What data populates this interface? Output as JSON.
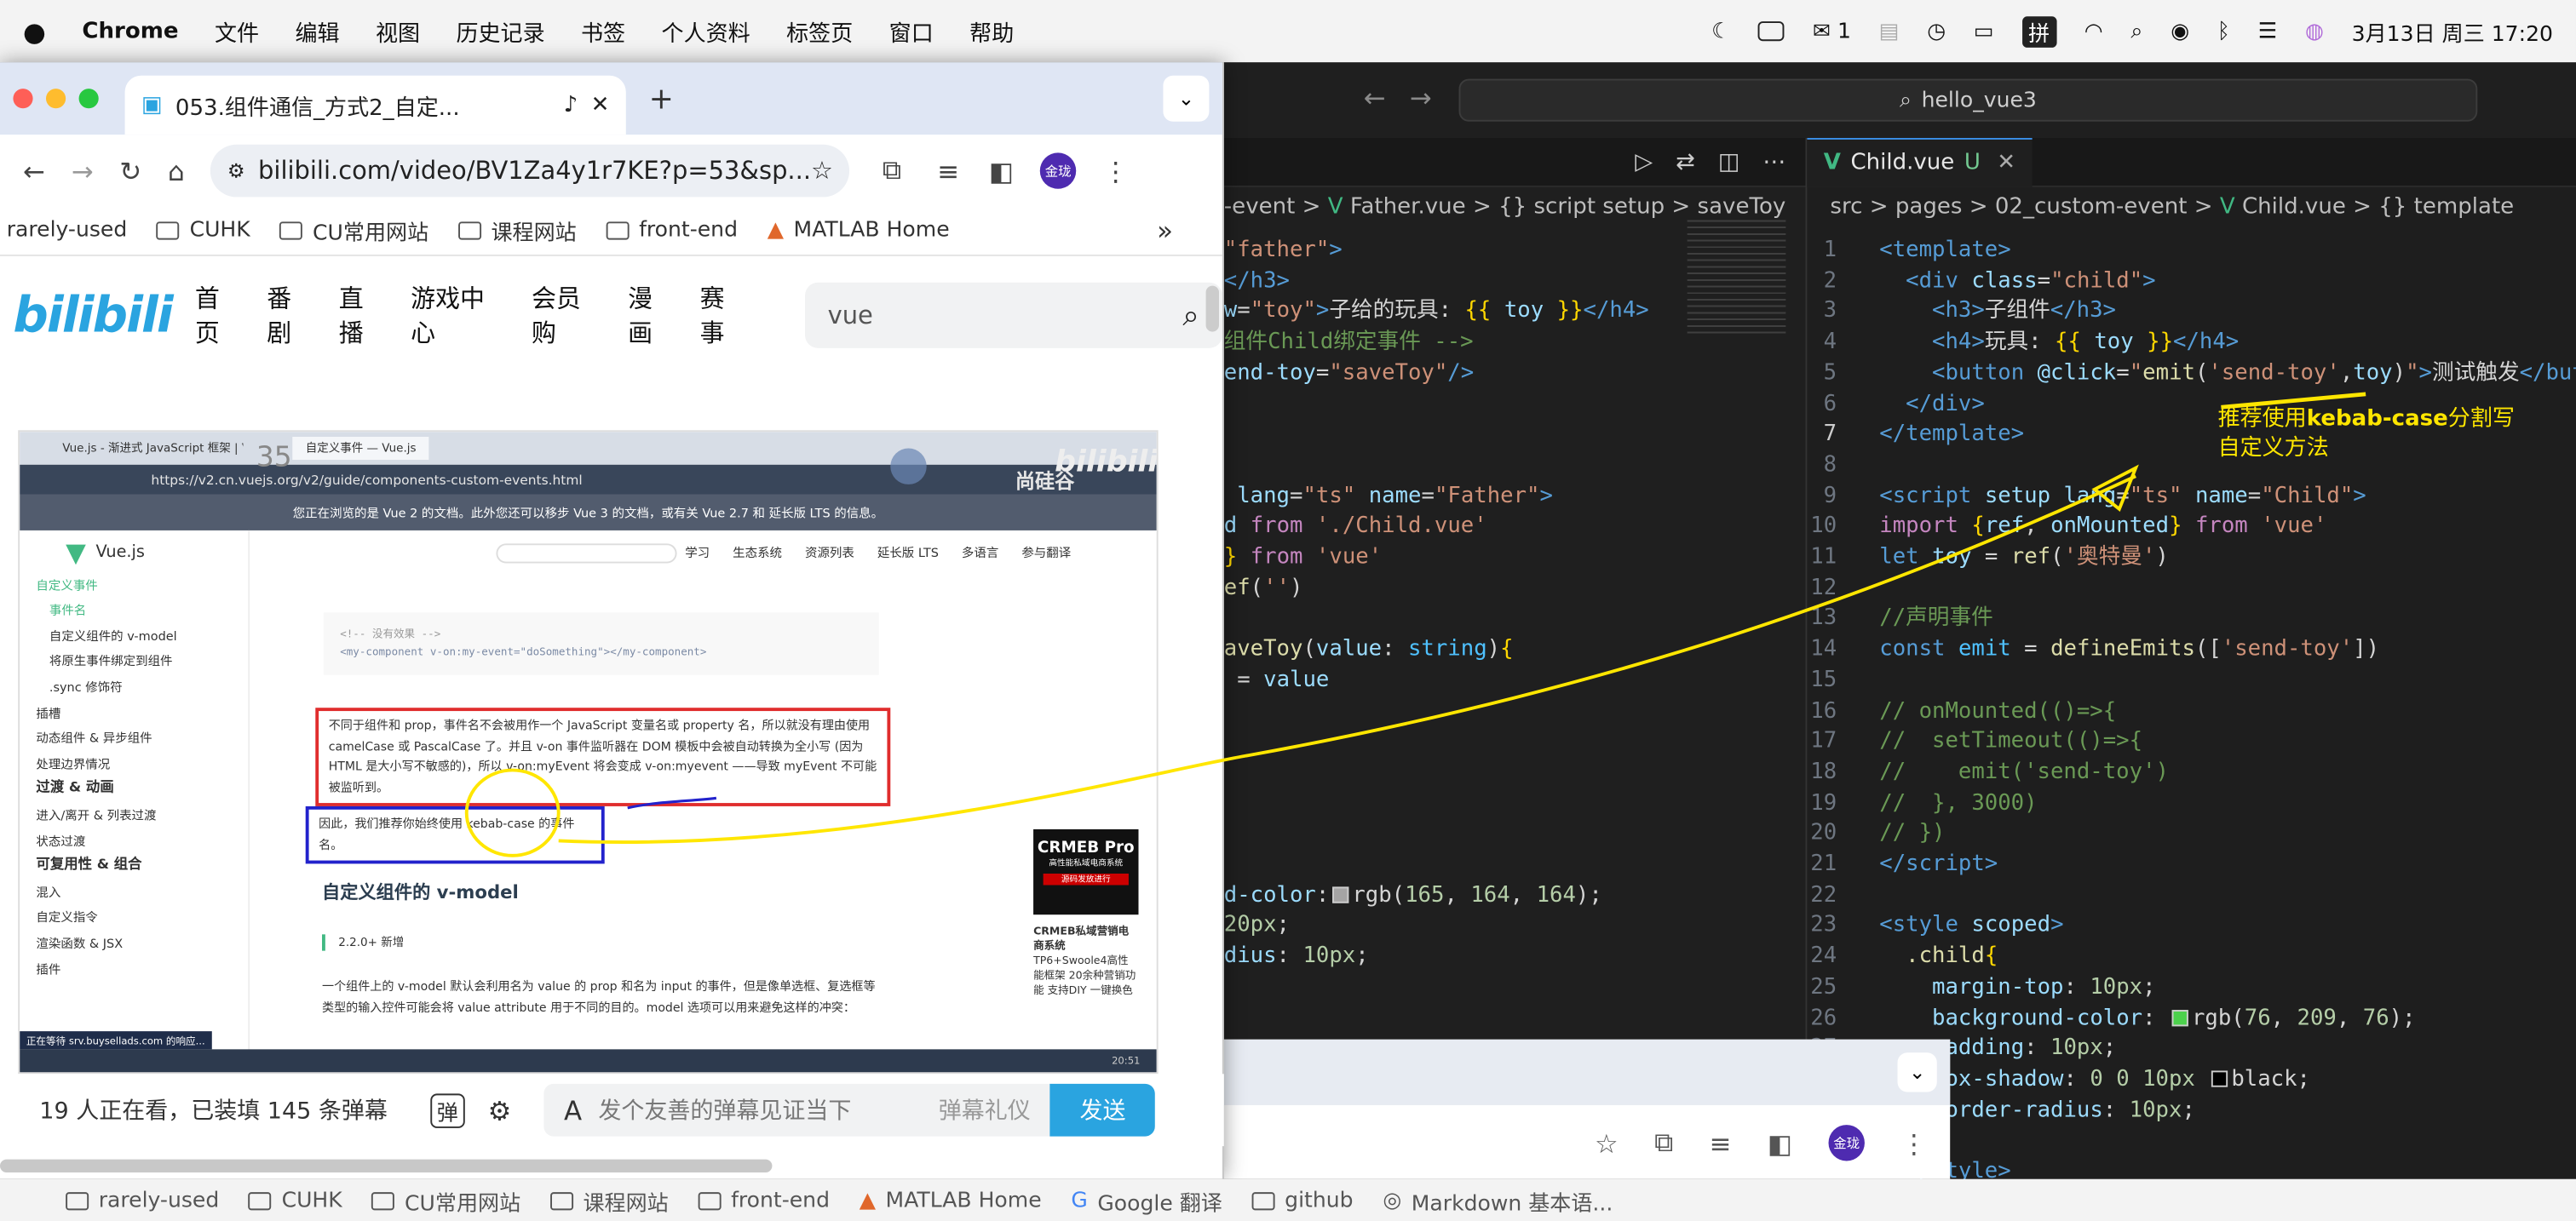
{
  "menubar": {
    "app": "Chrome",
    "items": [
      "文件",
      "编辑",
      "视图",
      "历史记录",
      "书签",
      "个人资料",
      "标签页",
      "窗口",
      "帮助"
    ],
    "wechat_count": "1",
    "ime": "拼",
    "datetime": "3月13日 周三 17:20"
  },
  "editor": {
    "search": "hello_vue3",
    "left_crumbs": [
      "-event",
      ">",
      "Father.vue",
      ">",
      "{} script setup",
      ">",
      "saveToy"
    ],
    "right_tab": {
      "name": "Child.vue",
      "status": "U"
    },
    "right_crumbs": [
      "src",
      ">",
      "pages",
      ">",
      "02_custom-event",
      ">",
      "Child.vue",
      ">",
      "{} template"
    ]
  },
  "chrome": {
    "tab_title": "053.组件通信_方式2_自定...",
    "url": "bilibili.com/video/BV1Za4y1r7KE?p=53&sp...",
    "avatar": "金珑",
    "bookmarks": [
      "rarely-used",
      "CUHK",
      "CU常用网站",
      "课程网站",
      "front-end",
      "MATLAB Home"
    ],
    "bili": {
      "logo": "bilibili",
      "nav": [
        "首页",
        "番剧",
        "直播",
        "游戏中心",
        "会员购",
        "漫画",
        "赛事"
      ],
      "search": "vue",
      "danmaku": {
        "viewers": "19 人正在看，已装填 145 条弹幕",
        "placeholder": "发个友善的弹幕见证当下",
        "etiquette": "弹幕礼仪",
        "send": "发送"
      }
    }
  },
  "video": {
    "tabs": [
      "Vue.js - 渐进式 JavaScript 框架 | Vue.js",
      "自定义事件 — Vue.js"
    ],
    "url": "https://v2.cn.vuejs.org/v2/guide/components-custom-events.html",
    "banner": "您正在浏览的是 Vue 2 的文档。此外您还可以移步 Vue 3 的文档，或有关 Vue 2.7 和 延长版 LTS 的信息。",
    "brand": "尚硅谷",
    "counter": "35",
    "nav": [
      "学习",
      "生态系统",
      "资源列表",
      "延长版 LTS",
      "多语言",
      "参与翻译"
    ],
    "sidebar": [
      "自定义事件",
      "事件名",
      "自定义组件的 v-model",
      "将原生事件绑定到组件",
      ".sync 修饰符",
      "插槽",
      "动态组件 & 异步组件",
      "处理边界情况",
      "过渡 & 动画",
      "进入/离开 & 列表过渡",
      "状态过渡",
      "可复用性 & 组合",
      "混入",
      "自定义指令",
      "渲染函数 & JSX",
      "插件"
    ],
    "code_comment": "<!-- 没有效果 -->",
    "code_line": "<my-component v-on:my-event=\"doSomething\"></my-component>",
    "para1": "不同于组件和 prop，事件名不会被用作一个 JavaScript 变量名或 property 名，所以就没有理由使用 camelCase 或 PascalCase 了。并且 v-on 事件监听器在 DOM 模板中会被自动转换为全小写 (因为 HTML 是大小写不敏感的)，所以 v-on:myEvent 将会变成 v-on:myevent ——导致 myEvent 不可能被监听到。",
    "para2": "因此，我们推荐你始终使用 kebab-case 的事件名。",
    "h2": "自定义组件的 v-model",
    "badge": "2.2.0+ 新增",
    "para3": "一个组件上的 v-model 默认会利用名为 value 的 prop 和名为 input 的事件，但是像单选框、复选框等类型的输入控件可能会将 value attribute 用于不同的目的。model 选项可以用来避免这样的冲突：",
    "ad_title": "CRMEB Pro",
    "ad_sub": "高性能私域电商系统",
    "ad_btn": "源码发放进行",
    "ad_desc": "CRMEB私域营销电商系统",
    "ad_desc2": "TP6+Swoole4高性能框架 20余种营销功能 支持DIY 一键换色",
    "status": "正在等待 srv.buysellads.com 的响应...",
    "time": "20:51"
  },
  "annotation": {
    "text_pre": "推荐使用",
    "text_bold": "kebab-case",
    "text_post": "分割写",
    "line2": "自定义方法",
    "color": "#ffe600"
  },
  "bottom_bookmarks": [
    "rarely-used",
    "CUHK",
    "CU常用网站",
    "课程网站",
    "front-end",
    "MATLAB Home",
    "Google 翻译",
    "github",
    "Markdown 基本语..."
  ]
}
